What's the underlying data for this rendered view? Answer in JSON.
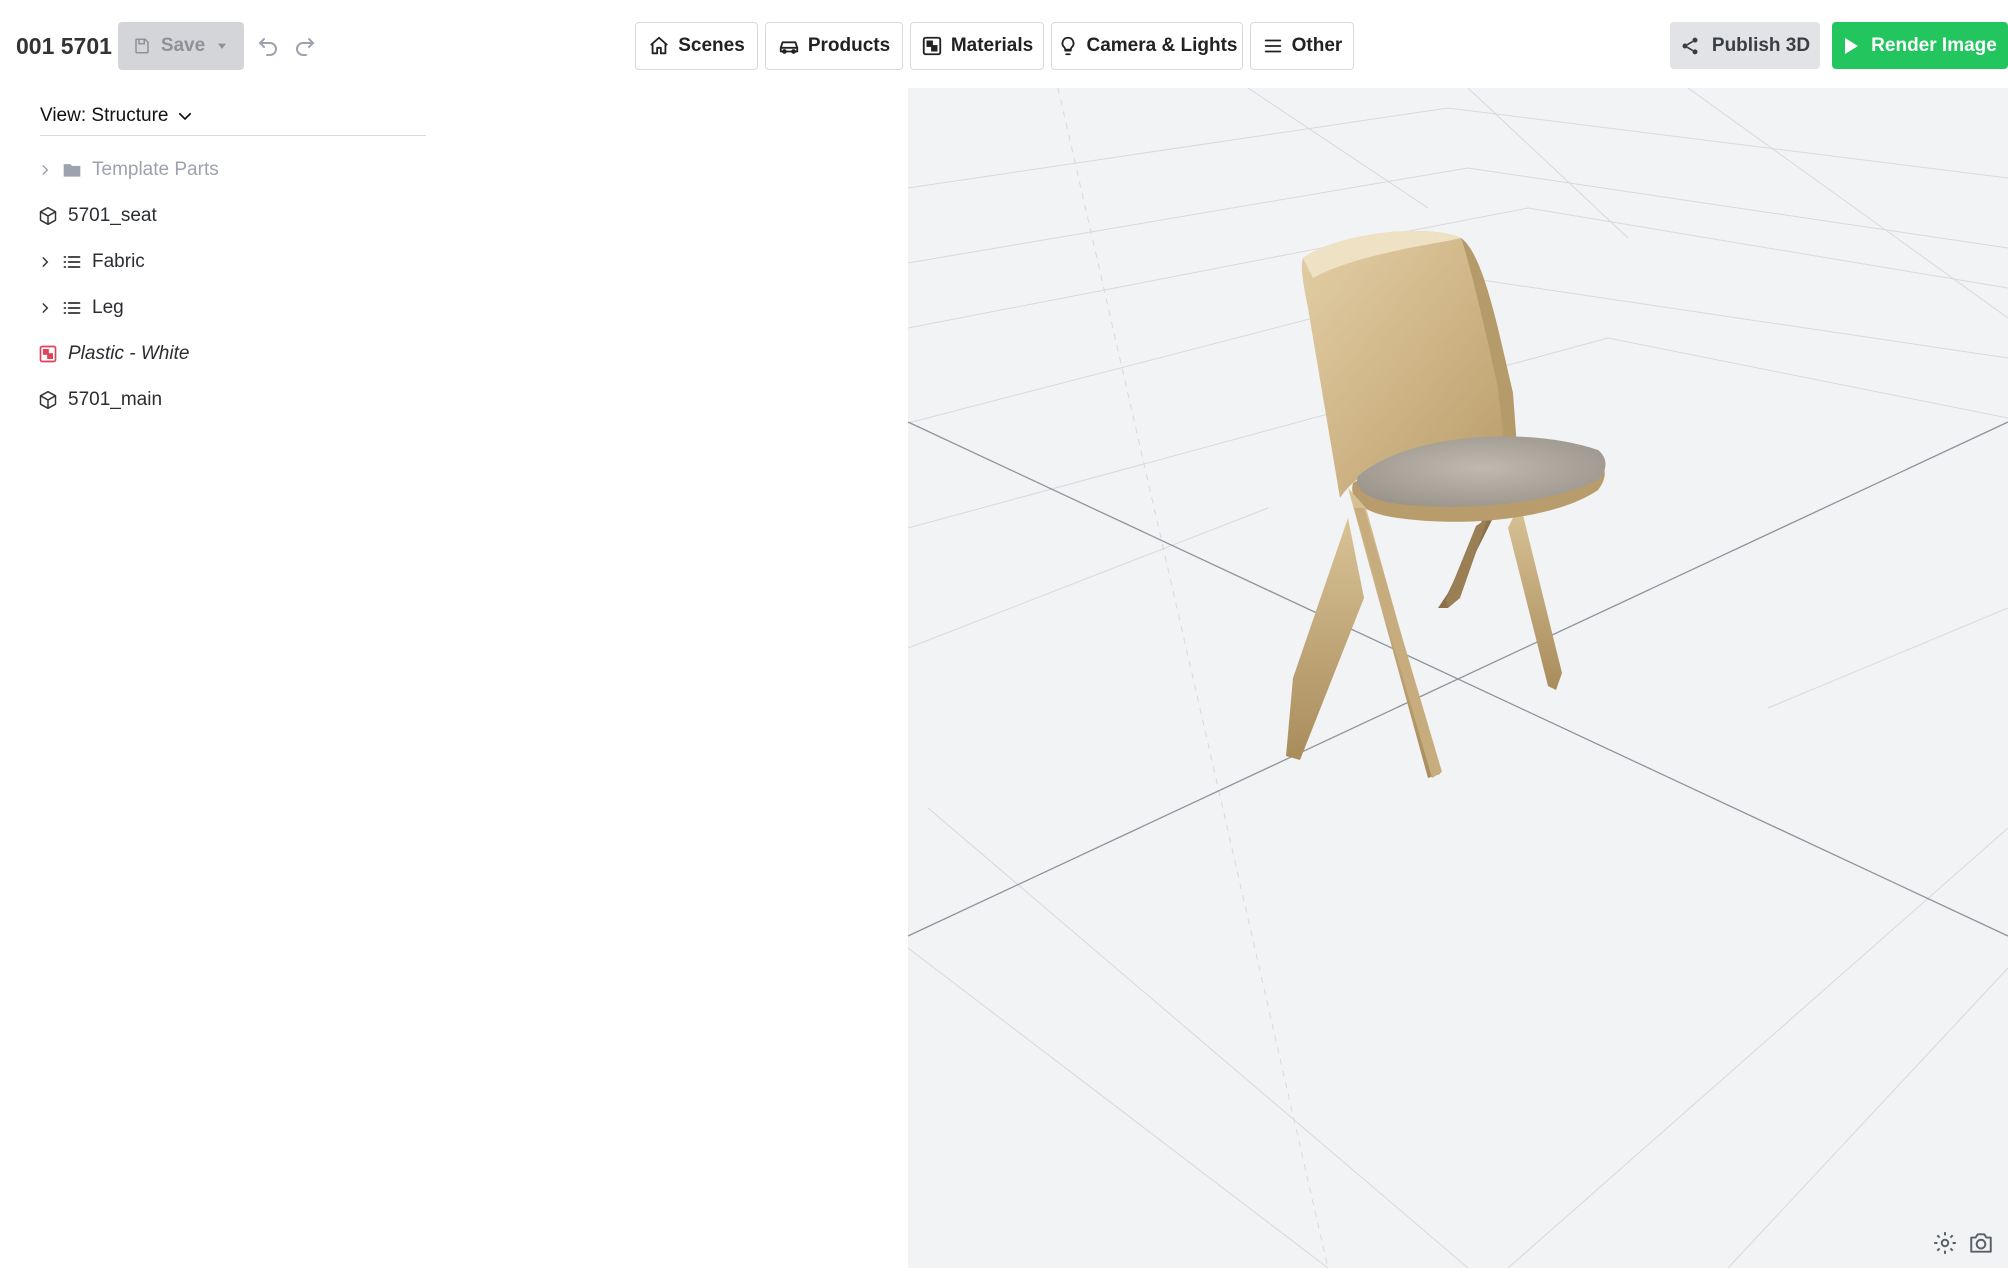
{
  "header": {
    "title": "001 5701",
    "save_label": "Save",
    "tabs": [
      {
        "label": "Scenes",
        "icon": "home-icon"
      },
      {
        "label": "Products",
        "icon": "car-icon"
      },
      {
        "label": "Materials",
        "icon": "material-icon"
      },
      {
        "label": "Camera & Lights",
        "icon": "lightbulb-icon"
      },
      {
        "label": "Other",
        "icon": "menu-icon"
      }
    ],
    "publish_label": "Publish 3D",
    "render_label": "Render Image"
  },
  "sidebar": {
    "view_label": "View: Structure",
    "items": [
      {
        "label": "Template Parts",
        "icon": "folder-icon",
        "expandable": true
      },
      {
        "label": "5701_seat",
        "icon": "cube-icon",
        "expandable": false
      },
      {
        "label": "Fabric",
        "icon": "list-icon",
        "expandable": true
      },
      {
        "label": "Leg",
        "icon": "list-icon",
        "expandable": true
      },
      {
        "label": "Plastic - White",
        "icon": "material-swatch-icon",
        "expandable": false
      },
      {
        "label": "5701_main",
        "icon": "cube-icon",
        "expandable": false
      }
    ]
  },
  "viewport": {
    "object": "chair-model",
    "toolbar_icons": [
      "gear-icon",
      "camera-icon"
    ]
  },
  "colors": {
    "accent_green": "#22c55e",
    "viewport_bg": "#f2f3f5",
    "material_swatch": "#e0435a"
  }
}
